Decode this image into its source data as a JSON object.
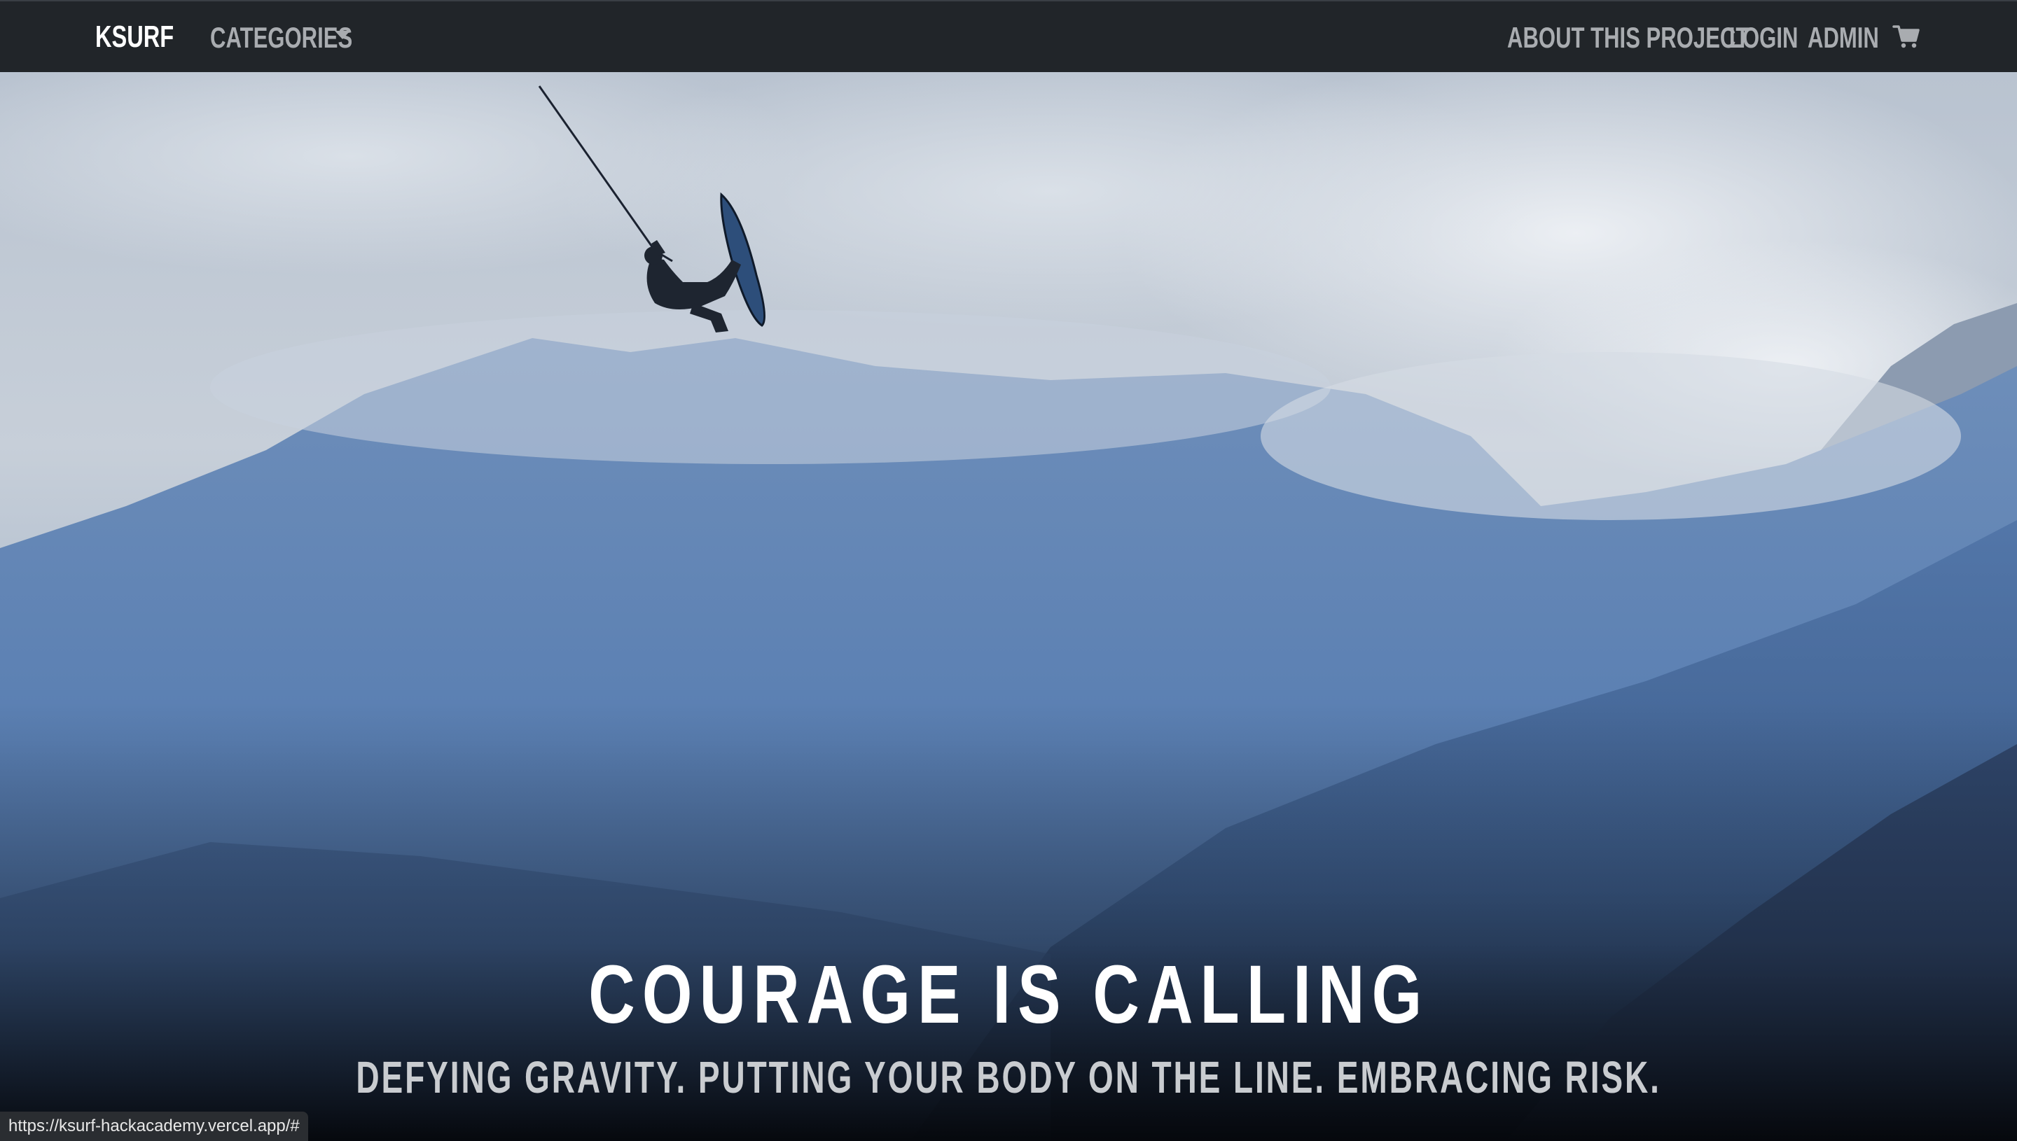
{
  "navbar": {
    "brand": "KSURF",
    "categories_label": "CATEGORIES",
    "about_label": "ABOUT THIS PROJECT",
    "login_label": "LOGIN",
    "admin_label": "ADMIN",
    "cart_icon": "cart-icon",
    "caret_icon": "caret-down-icon"
  },
  "hero": {
    "title": "COURAGE IS CALLING",
    "subtitle": "DEFYING GRAVITY. PUTTING YOUR BODY ON THE LINE. EMBRACING RISK."
  },
  "status_bar": {
    "url": "https://ksurf-hackacademy.vercel.app/#"
  },
  "colors": {
    "navbar_bg": "#212529",
    "brand_text": "#ffffff",
    "nav_link_text": "#a9acb0",
    "hero_title": "#ffffff",
    "hero_subtitle": "#c9ccd0"
  }
}
